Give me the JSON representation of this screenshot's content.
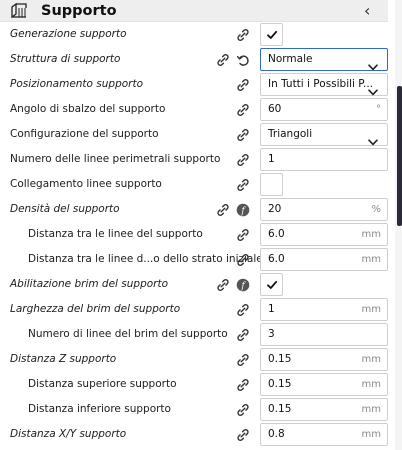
{
  "section": {
    "title": "Supporto",
    "icon": "support-section-icon",
    "collapse_glyph": "‹"
  },
  "colors": {
    "header_bg": "#eeeeee",
    "focus_border": "#2d6bc6",
    "scroll_thumb": "#2a2a3a"
  },
  "settings": [
    {
      "label": "Generazione supporto",
      "italic": true,
      "indent": 0,
      "control": "checkbox",
      "checked": true,
      "icons": [
        "link-icon"
      ]
    },
    {
      "label": "Struttura di supporto",
      "italic": true,
      "indent": 0,
      "control": "select",
      "value": "Normale",
      "focused": true,
      "icons": [
        "link-icon",
        "reset-icon"
      ]
    },
    {
      "label": "Posizionamento supporto",
      "italic": true,
      "indent": 0,
      "control": "select",
      "value": "In Tutti i Possibili P...",
      "icons": [
        "link-icon"
      ]
    },
    {
      "label": "Angolo di sbalzo del supporto",
      "italic": false,
      "indent": 0,
      "control": "number",
      "value": "60",
      "unit": "°",
      "icons": [
        "link-icon"
      ]
    },
    {
      "label": "Configurazione del supporto",
      "italic": false,
      "indent": 0,
      "control": "select",
      "value": "Triangoli",
      "icons": [
        "link-icon"
      ]
    },
    {
      "label": "Numero delle linee perimetrali supporto",
      "italic": false,
      "indent": 0,
      "control": "number",
      "value": "1",
      "unit": "",
      "icons": [
        "link-icon"
      ]
    },
    {
      "label": "Collegamento linee supporto",
      "italic": false,
      "indent": 0,
      "control": "checkbox",
      "checked": false,
      "icons": [
        "link-icon"
      ]
    },
    {
      "label": "Densità del supporto",
      "italic": true,
      "indent": 0,
      "control": "number",
      "value": "20",
      "unit": "%",
      "icons": [
        "link-icon",
        "function-icon"
      ]
    },
    {
      "label": "Distanza tra le linee del supporto",
      "italic": false,
      "indent": 1,
      "control": "number",
      "value": "6.0",
      "unit": "mm",
      "icons": [
        "link-icon"
      ]
    },
    {
      "label": "Distanza tra le linee d...o dello strato iniziale",
      "italic": false,
      "indent": 1,
      "control": "number",
      "value": "6.0",
      "unit": "mm",
      "icons": [
        "link-icon"
      ]
    },
    {
      "label": "Abilitazione brim del supporto",
      "italic": true,
      "indent": 0,
      "control": "checkbox",
      "checked": true,
      "icons": [
        "link-icon",
        "function-icon"
      ]
    },
    {
      "label": "Larghezza del brim del supporto",
      "italic": true,
      "indent": 0,
      "control": "number",
      "value": "1",
      "unit": "mm",
      "icons": [
        "link-icon"
      ]
    },
    {
      "label": "Numero di linee del brim del supporto",
      "italic": false,
      "indent": 1,
      "control": "number",
      "value": "3",
      "unit": "",
      "icons": [
        "link-icon"
      ]
    },
    {
      "label": "Distanza Z supporto",
      "italic": true,
      "indent": 0,
      "control": "number",
      "value": "0.15",
      "unit": "mm",
      "icons": [
        "link-icon"
      ]
    },
    {
      "label": "Distanza superiore supporto",
      "italic": false,
      "indent": 1,
      "control": "number",
      "value": "0.15",
      "unit": "mm",
      "icons": [
        "link-icon"
      ]
    },
    {
      "label": "Distanza inferiore supporto",
      "italic": false,
      "indent": 1,
      "control": "number",
      "value": "0.15",
      "unit": "mm",
      "icons": [
        "link-icon"
      ]
    },
    {
      "label": "Distanza X/Y supporto",
      "italic": true,
      "indent": 0,
      "control": "number",
      "value": "0.8",
      "unit": "mm",
      "icons": [
        "link-icon"
      ]
    }
  ]
}
